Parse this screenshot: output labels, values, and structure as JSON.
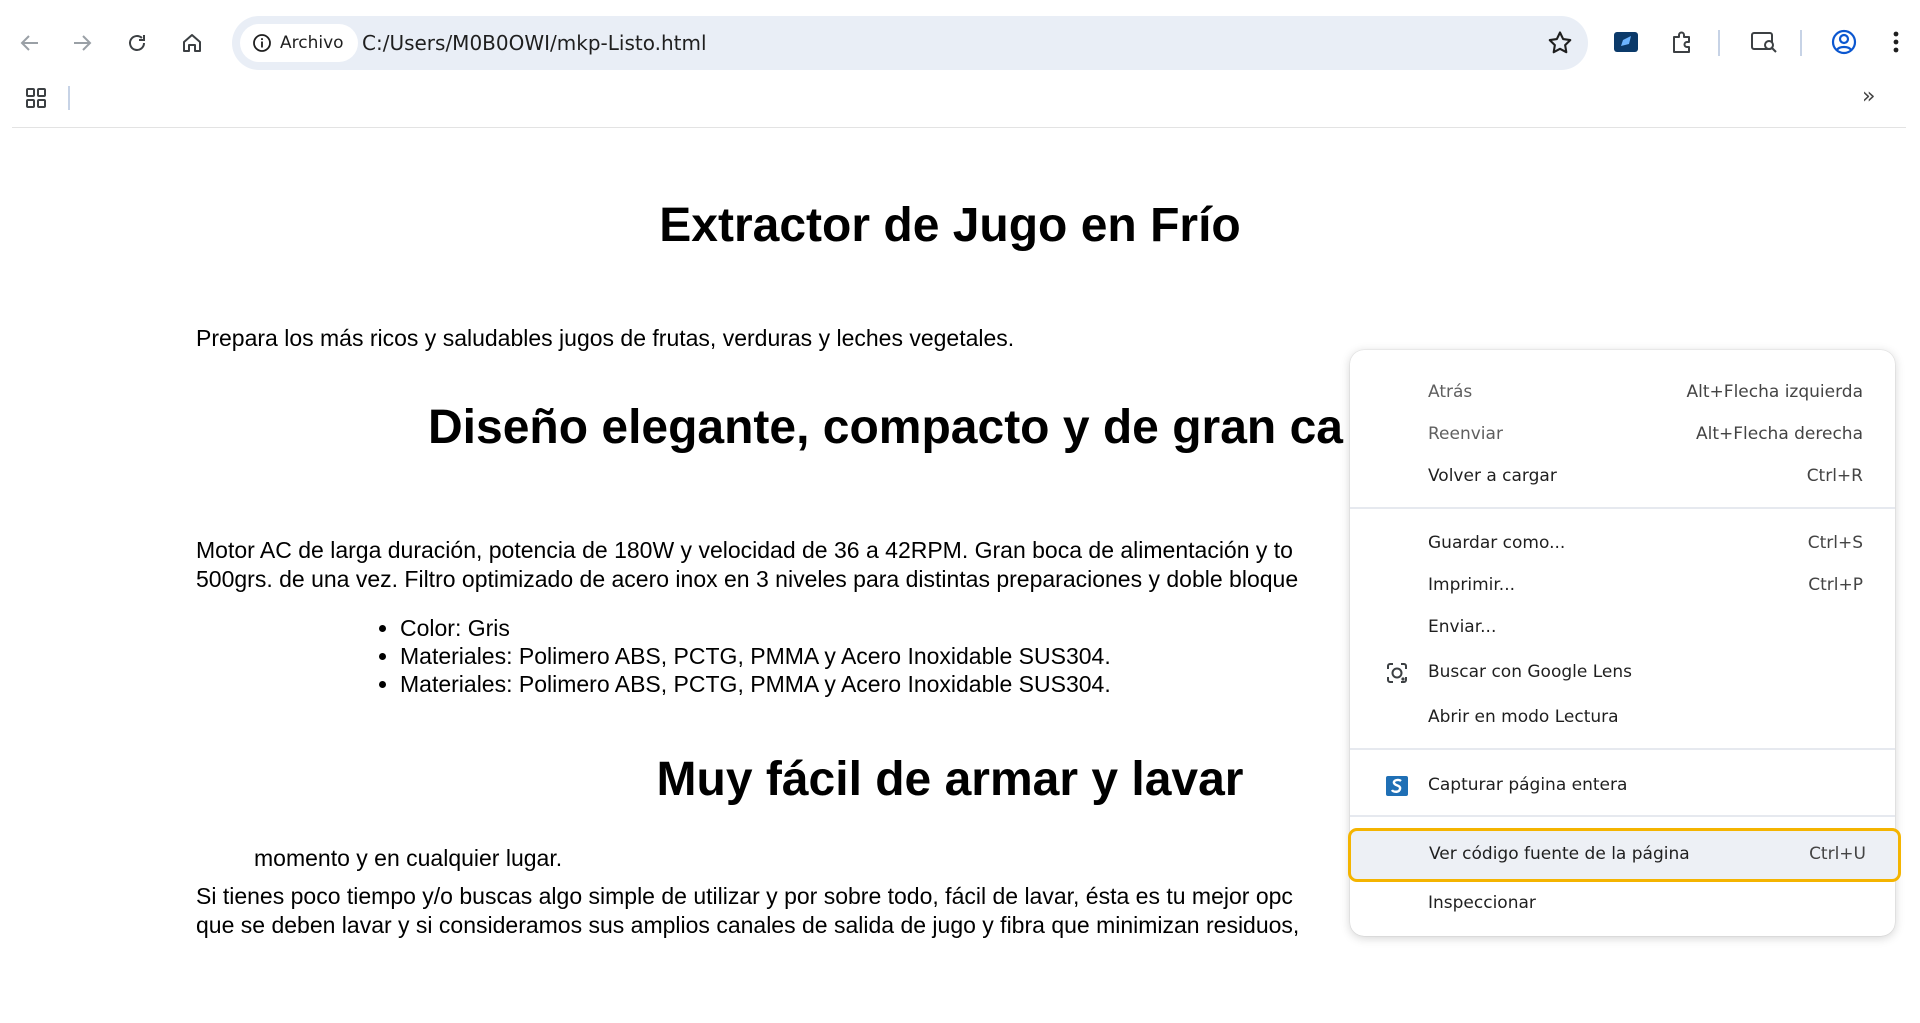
{
  "browser": {
    "site_chip": "Archivo",
    "url": "C:/Users/M0B0OWI/mkp-Listo.html",
    "overflow": "»"
  },
  "page": {
    "title": "Extractor de Jugo en Frío",
    "intro": "Prepara los más ricos y saludables jugos de frutas, verduras y leches vegetales.",
    "section1_title": "Diseño elegante, compacto y de gran ca",
    "motor_line1": "Motor AC de larga duración, potencia de 180W y velocidad de 36 a 42RPM. Gran boca de alimentación y to",
    "motor_line2": "500grs. de una vez. Filtro optimizado de acero inox en 3 niveles para distintas preparaciones y doble bloque",
    "features": [
      "Color: Gris",
      "Materiales: Polimero ABS, PCTG, PMMA y Acero Inoxidable SUS304.",
      "Materiales: Polimero ABS, PCTG, PMMA y Acero Inoxidable SUS304."
    ],
    "section2_title": "Muy fácil de armar y lavar",
    "fragment": "momento y en cualquier lugar.",
    "closing_line1": "Si tienes poco tiempo y/o buscas algo simple de utilizar y por sobre todo, fácil de lavar, ésta es tu mejor opc",
    "closing_line2": "que se deben lavar y si consideramos sus amplios canales de salida de jugo y fibra que minimizan residuos,"
  },
  "context_menu": {
    "items": [
      {
        "label": "Atrás",
        "shortcut": "Alt+Flecha izquierda"
      },
      {
        "label": "Reenviar",
        "shortcut": "Alt+Flecha derecha"
      },
      {
        "label": "Volver a cargar",
        "shortcut": "Ctrl+R"
      },
      {
        "label": "Guardar como...",
        "shortcut": "Ctrl+S"
      },
      {
        "label": "Imprimir...",
        "shortcut": "Ctrl+P"
      },
      {
        "label": "Enviar...",
        "shortcut": ""
      },
      {
        "label": "Buscar con Google Lens",
        "shortcut": ""
      },
      {
        "label": "Abrir en modo Lectura",
        "shortcut": ""
      },
      {
        "label": "Capturar página entera",
        "shortcut": ""
      },
      {
        "label": "Ver código fuente de la página",
        "shortcut": "Ctrl+U"
      },
      {
        "label": "Inspeccionar",
        "shortcut": ""
      }
    ],
    "highlight_color": "#f4b400"
  }
}
